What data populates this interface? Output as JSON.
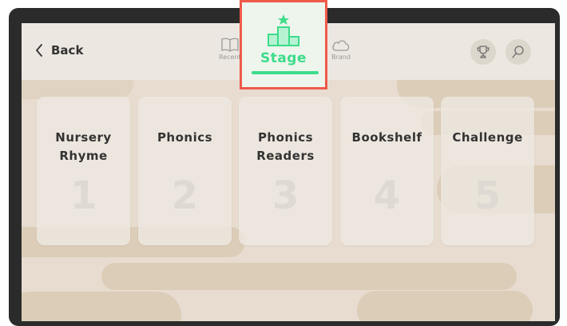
{
  "header": {
    "back_label": "Back",
    "tabs": [
      {
        "label": "Recent",
        "icon": "book-icon"
      },
      {
        "label": "Stage",
        "icon": "podium-icon",
        "selected": true
      },
      {
        "label": "Brand",
        "icon": "cloud-icon"
      }
    ],
    "actions": [
      {
        "name": "trophy-icon"
      },
      {
        "name": "search-icon"
      }
    ]
  },
  "cards": [
    {
      "title": "Nursery Rhyme",
      "number": "1"
    },
    {
      "title": "Phonics",
      "number": "2"
    },
    {
      "title": "Phonics Readers",
      "number": "3"
    },
    {
      "title": "Bookshelf",
      "number": "4"
    },
    {
      "title": "Challenge",
      "number": "5"
    }
  ],
  "colors": {
    "accent": "#3ddc8a",
    "highlight_border": "#ef5a4a",
    "background": "#e7dccf"
  }
}
